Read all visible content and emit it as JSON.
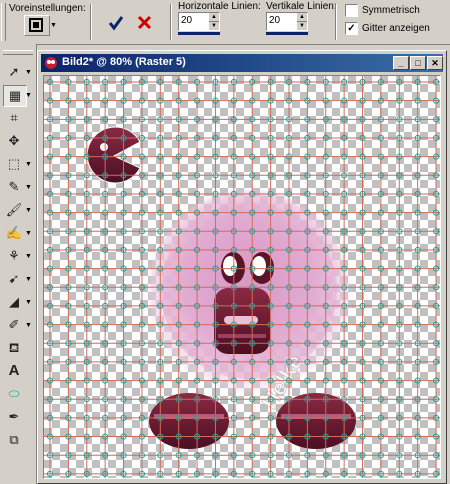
{
  "options": {
    "presets_label": "Voreinstellungen:",
    "horizontal_label": "Horizontale Linien:",
    "horizontal_value": "20",
    "vertical_label": "Vertikale Linien:",
    "vertical_value": "20",
    "symmetric_label": "Symmetrisch",
    "symmetric_checked": false,
    "show_grid_label": "Gitter anzeigen",
    "show_grid_checked": true,
    "apply_icon": "checkmark-icon",
    "cancel_icon": "x-icon"
  },
  "palette": {
    "tools": [
      "arrow-icon",
      "mesh-warp-icon",
      "crop-icon",
      "move-icon",
      "selection-icon",
      "dropper-icon",
      "paint-brush-icon",
      "clone-brush-icon",
      "color-replacer-icon",
      "push-brush-icon",
      "eraser-icon",
      "picture-tube-icon",
      "paint-bucket-icon",
      "text-icon",
      "preset-shape-icon",
      "pen-icon",
      "object-selector-icon"
    ]
  },
  "window": {
    "title": "Bild2* @  80% (Raster 5)",
    "buttons": [
      "_",
      "□",
      "✕"
    ]
  },
  "text_art": "Helke",
  "colors": {
    "title_start": "#0a246a",
    "title_end": "#3a6ea5",
    "grid_line": "#d46a5a",
    "grid_node": "#17a6a0",
    "fur": "#e0a8cf",
    "body": "#6b1e32",
    "accept": "#0a246a",
    "cancel": "#cc0000"
  }
}
